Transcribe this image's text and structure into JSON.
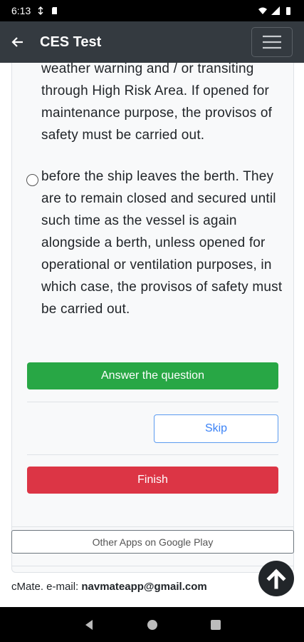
{
  "status_bar": {
    "time": "6:13"
  },
  "app_bar": {
    "title": "CES Test"
  },
  "question": {
    "option_a_tail": "weather warning and / or transiting through High Risk Area. If opened for maintenance purpose, the provisos of safety must be carried out.",
    "option_b": "before the ship leaves the berth. They are to remain closed and secured until such time as the vessel is again alongside a berth, unless opened for operational or ventilation purposes, in which case, the provisos of safety must be carried out."
  },
  "buttons": {
    "answer": "Answer the question",
    "skip": "Skip",
    "finish": "Finish",
    "other_apps": "Other Apps on Google Play"
  },
  "footer": {
    "prefix": "cMate. e-mail: ",
    "email": "navmateapp@gmail.com"
  },
  "colors": {
    "app_bar": "#343a40",
    "success": "#28a745",
    "danger": "#dc3545",
    "primary_outline": "#3b82f6"
  }
}
